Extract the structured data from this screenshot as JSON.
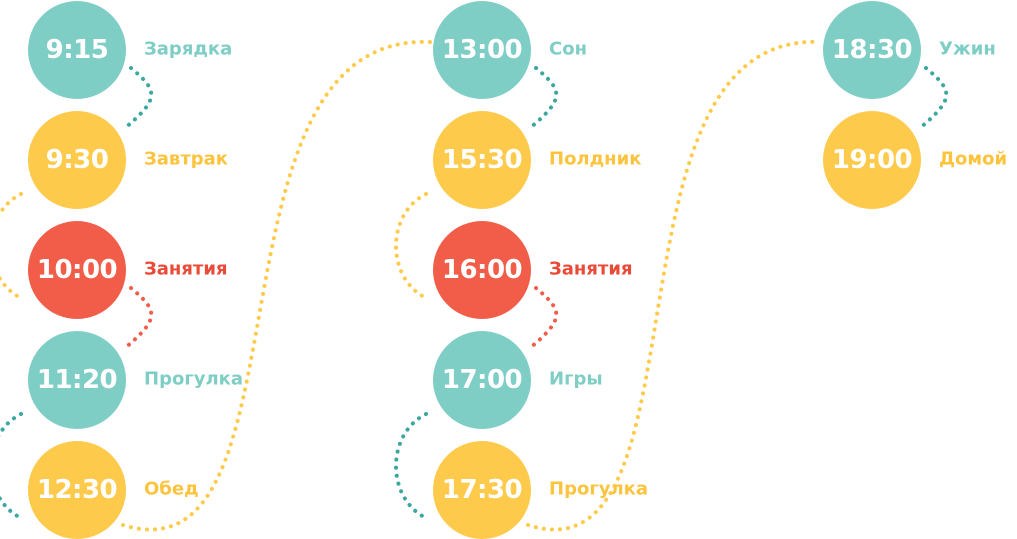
{
  "colors": {
    "teal": "#7fcec6",
    "yellow": "#fdca4b",
    "red": "#f15d49",
    "teal_text": "#7fcec6",
    "yellow_text": "#fcc43e",
    "red_text": "#ea4a37",
    "teal_dots": "#3aa8a0"
  },
  "schedule": [
    {
      "time": "9:15",
      "activity": "Зарядка",
      "color": "teal"
    },
    {
      "time": "9:30",
      "activity": "Завтрак",
      "color": "yellow"
    },
    {
      "time": "10:00",
      "activity": "Занятия",
      "color": "red"
    },
    {
      "time": "11:20",
      "activity": "Прогулка",
      "color": "teal"
    },
    {
      "time": "12:30",
      "activity": "Обед",
      "color": "yellow"
    },
    {
      "time": "13:00",
      "activity": "Сон",
      "color": "teal"
    },
    {
      "time": "15:30",
      "activity": "Полдник",
      "color": "yellow"
    },
    {
      "time": "16:00",
      "activity": "Занятия",
      "color": "red"
    },
    {
      "time": "17:00",
      "activity": "Игры",
      "color": "teal"
    },
    {
      "time": "17:30",
      "activity": "Прогулка",
      "color": "yellow"
    },
    {
      "time": "18:30",
      "activity": "Ужин",
      "color": "teal"
    },
    {
      "time": "19:00",
      "activity": "Домой",
      "color": "yellow"
    }
  ]
}
